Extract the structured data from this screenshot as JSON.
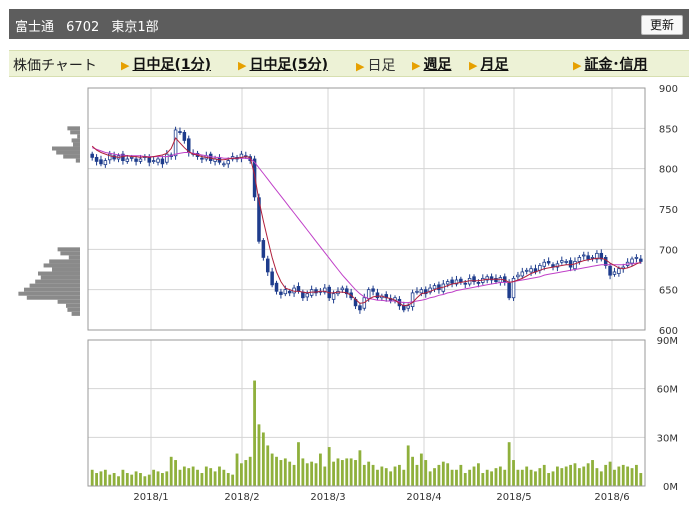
{
  "header": {
    "company": "富士通",
    "code": "6702",
    "market": "東京1部",
    "refresh_label": "更新"
  },
  "tabs": {
    "lead": "株価チャート",
    "items": [
      {
        "label": "日中足(1分)",
        "link": true
      },
      {
        "label": "日中足(5分)",
        "link": true
      },
      {
        "label": "日足",
        "link": false
      },
      {
        "label": "週足",
        "link": true
      },
      {
        "label": "月足",
        "link": true
      },
      {
        "label": "証金･信用",
        "link": true
      }
    ]
  },
  "colors": {
    "up_candle": "#ffffff",
    "down_candle": "#1e3c8c",
    "ma_short": "#b0203c",
    "ma_long": "#c040c8",
    "volume": "#8fb03c",
    "price_profile": "#8a8a8a",
    "grid": "#d4d4d4"
  },
  "chart_data": [
    {
      "type": "candlestick",
      "panel": "price",
      "y_unit": "yen",
      "ylim": [
        600,
        900
      ],
      "y_ticks": [
        "900",
        "850",
        "800",
        "750",
        "700",
        "650",
        "600"
      ],
      "x_ticks": [
        "2018/1",
        "2018/2",
        "2018/3",
        "2018/4",
        "2018/5",
        "2018/6"
      ],
      "grid": true,
      "close": [
        814,
        809,
        806,
        810,
        818,
        812,
        816,
        810,
        812,
        814,
        809,
        812,
        815,
        808,
        810,
        812,
        806,
        818,
        815,
        848,
        845,
        835,
        820,
        818,
        815,
        812,
        816,
        810,
        812,
        808,
        806,
        810,
        815,
        812,
        818,
        815,
        810,
        765,
        710,
        690,
        672,
        656,
        648,
        644,
        650,
        646,
        652,
        648,
        640,
        645,
        650,
        646,
        648,
        652,
        640,
        645,
        648,
        652,
        645,
        640,
        630,
        625,
        640,
        650,
        648,
        640,
        642,
        640,
        636,
        640,
        630,
        625,
        630,
        646,
        648,
        650,
        645,
        652,
        655,
        650,
        657,
        660,
        658,
        662,
        660,
        657,
        664,
        660,
        658,
        664,
        666,
        662,
        660,
        665,
        660,
        640,
        664,
        668,
        672,
        674,
        676,
        672,
        680,
        684,
        683,
        678,
        682,
        686,
        685,
        678,
        685,
        690,
        693,
        688,
        690,
        695,
        688,
        680,
        668,
        672,
        676,
        678,
        684,
        688,
        690,
        685
      ],
      "ma_short": [
        828,
        823,
        820,
        818,
        816,
        815,
        814,
        815,
        816,
        815,
        815,
        814,
        815,
        814,
        815,
        816,
        817,
        819,
        825,
        838,
        832,
        826,
        821,
        818,
        817,
        815,
        814,
        813,
        812,
        811,
        811,
        812,
        813,
        813,
        814,
        815,
        814,
        792,
        760,
        735,
        712,
        690,
        672,
        660,
        652,
        650,
        648,
        648,
        647,
        646,
        647,
        647,
        648,
        648,
        646,
        646,
        647,
        647,
        646,
        643,
        638,
        633,
        634,
        638,
        641,
        642,
        642,
        640,
        639,
        637,
        633,
        630,
        631,
        634,
        640,
        645,
        646,
        648,
        650,
        652,
        653,
        655,
        657,
        658,
        659,
        660,
        661,
        661,
        661,
        662,
        663,
        663,
        663,
        663,
        662,
        659,
        660,
        662,
        664,
        667,
        670,
        672,
        674,
        676,
        677,
        678,
        679,
        680,
        681,
        681,
        682,
        684,
        686,
        687,
        688,
        689,
        689,
        687,
        683,
        680,
        677,
        676,
        677,
        679,
        682,
        684
      ],
      "ma_long": [
        826,
        824,
        822,
        820,
        819,
        818,
        817,
        817,
        816,
        816,
        816,
        816,
        815,
        815,
        815,
        815,
        815,
        815,
        816,
        818,
        819,
        820,
        820,
        819,
        818,
        817,
        816,
        815,
        814,
        814,
        813,
        813,
        813,
        813,
        813,
        813,
        812,
        808,
        801,
        794,
        787,
        780,
        773,
        766,
        759,
        752,
        745,
        738,
        731,
        724,
        717,
        710,
        703,
        696,
        689,
        682,
        675,
        668,
        662,
        656,
        650,
        645,
        641,
        639,
        638,
        637,
        637,
        636,
        636,
        636,
        635,
        634,
        634,
        635,
        636,
        637,
        638,
        640,
        641,
        643,
        644,
        646,
        647,
        649,
        650,
        651,
        652,
        653,
        654,
        655,
        656,
        657,
        658,
        659,
        659,
        659,
        660,
        661,
        662,
        663,
        664,
        665,
        666,
        668,
        669,
        670,
        671,
        672,
        673,
        674,
        675,
        676,
        677,
        678,
        679,
        680,
        681,
        681,
        681,
        681,
        681,
        681,
        682,
        682,
        683,
        683
      ]
    },
    {
      "type": "bar",
      "panel": "volume",
      "y_unit": "shares",
      "ylim": [
        0,
        90000000
      ],
      "y_ticks": [
        "90M",
        "60M",
        "30M",
        "0M"
      ],
      "grid": true,
      "values": [
        10,
        8,
        9,
        10,
        7,
        8,
        6,
        10,
        8,
        7,
        9,
        8,
        6,
        7,
        10,
        9,
        8,
        9,
        18,
        16,
        10,
        12,
        11,
        12,
        10,
        8,
        12,
        11,
        9,
        12,
        10,
        8,
        7,
        20,
        14,
        16,
        18,
        65,
        38,
        33,
        25,
        20,
        18,
        16,
        17,
        15,
        13,
        27,
        17,
        14,
        15,
        14,
        20,
        12,
        24,
        15,
        17,
        16,
        17,
        17,
        16,
        22,
        13,
        15,
        13,
        10,
        12,
        11,
        9,
        12,
        13,
        10,
        25,
        18,
        13,
        20,
        16,
        9,
        11,
        13,
        15,
        14,
        10,
        10,
        13,
        8,
        10,
        12,
        14,
        8,
        10,
        9,
        11,
        12,
        10,
        27,
        16,
        10,
        10,
        12,
        10,
        9,
        11,
        13,
        8,
        9,
        12,
        11,
        12,
        13,
        14,
        11,
        12,
        14,
        16,
        11,
        9,
        13,
        15,
        10,
        12,
        13,
        12,
        11,
        13,
        8
      ]
    },
    {
      "type": "bar",
      "panel": "price-volume-profile",
      "orientation": "horizontal",
      "price_levels": [
        850,
        845,
        840,
        835,
        830,
        825,
        820,
        815,
        810,
        805,
        800,
        795,
        790,
        785,
        780,
        775,
        770,
        765,
        760,
        755,
        750,
        745,
        740,
        735,
        730,
        725,
        720,
        715,
        710,
        705,
        700,
        695,
        690,
        685,
        680,
        675,
        670,
        665,
        660,
        655,
        650,
        645,
        640,
        635,
        630,
        625,
        620
      ],
      "relative_volume": [
        0.45,
        0.35,
        0.1,
        0.3,
        0.25,
        1.0,
        0.85,
        0.6,
        0.15,
        0,
        0,
        0,
        0,
        0,
        0,
        0,
        0,
        0,
        0,
        0,
        0,
        0,
        0,
        0,
        0,
        0,
        0,
        0,
        0,
        0,
        0.8,
        0.7,
        0.4,
        1.1,
        1.3,
        1.0,
        1.5,
        1.4,
        1.6,
        1.8,
        2.0,
        2.2,
        1.9,
        0.8,
        0.5,
        0.45,
        0.3
      ]
    }
  ]
}
